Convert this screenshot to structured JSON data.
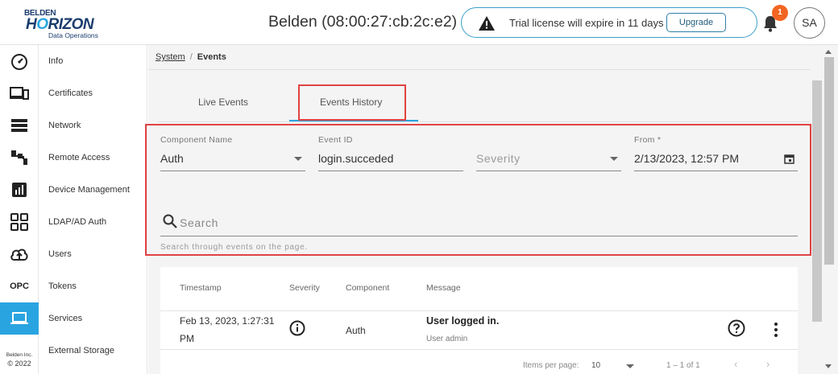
{
  "header": {
    "logo": {
      "line1": "BELDEN",
      "line2a": "H",
      "line2b": "RIZON",
      "line3": "Data Operations"
    },
    "device_title": "Belden (08:00:27:cb:2c:e2)",
    "trial_text": "Trial license will expire in 11 days",
    "upgrade_label": "Upgrade",
    "notification_count": "1",
    "avatar_initials": "SA"
  },
  "rail": {
    "opc_label": "OPC",
    "footer_company": "Belden Inc.",
    "footer_copyright": "© 2022"
  },
  "nav": {
    "items": [
      "Info",
      "Certificates",
      "Network",
      "Remote Access",
      "Device Management",
      "LDAP/AD Auth",
      "Users",
      "Tokens",
      "Services",
      "External Storage"
    ]
  },
  "breadcrumb": {
    "parent": "System",
    "separator": "/",
    "current": "Events"
  },
  "tabs": {
    "live": "Live Events",
    "history": "Events History"
  },
  "filters": {
    "component_label": "Component Name",
    "component_value": "Auth",
    "event_id_label": "Event ID",
    "event_id_value": "login.succeded",
    "severity_placeholder": "Severity",
    "from_label": "From *",
    "from_value": "2/13/2023, 12:57 PM",
    "search_placeholder": "Search",
    "search_hint": "Search through events on the page."
  },
  "table": {
    "headers": {
      "timestamp": "Timestamp",
      "severity": "Severity",
      "component": "Component",
      "message": "Message"
    },
    "rows": [
      {
        "timestamp_line1": "Feb 13, 2023, 1:27:31",
        "timestamp_line2": "PM",
        "component": "Auth",
        "message_title": "User logged in.",
        "message_detail": "User admin"
      }
    ],
    "pager": {
      "items_per_page_label": "Items per page:",
      "items_per_page_value": "10",
      "range": "1 – 1 of 1"
    }
  },
  "colors": {
    "accent": "#2aa4e0",
    "highlight": "#e04343",
    "badge": "#f26522",
    "brand": "#1b3d6e"
  }
}
